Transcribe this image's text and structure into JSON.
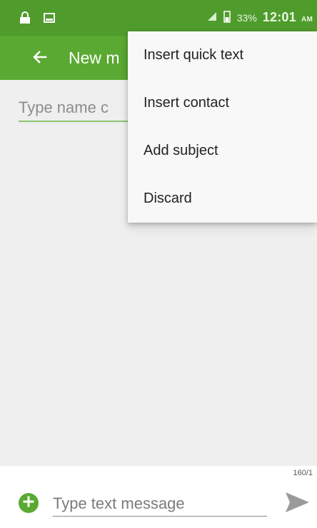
{
  "status_bar": {
    "battery_text": "33%",
    "time": "12:01",
    "ampm": "AM",
    "icons": [
      "lock-icon",
      "screenshot-icon",
      "signal-icon",
      "battery-icon"
    ]
  },
  "app_bar": {
    "title": "New m",
    "back_icon": "arrow-left-icon",
    "background_color": "#5aa932",
    "status_color": "#4f9b2c"
  },
  "recipient": {
    "placeholder": "Type name c"
  },
  "overflow_menu": {
    "items": [
      {
        "label": "Insert quick text"
      },
      {
        "label": "Insert contact"
      },
      {
        "label": "Add subject"
      },
      {
        "label": "Discard"
      }
    ]
  },
  "compose": {
    "counter": "160/1",
    "placeholder": "Type text message",
    "add_icon": "plus-circle-icon",
    "send_icon": "send-icon"
  }
}
